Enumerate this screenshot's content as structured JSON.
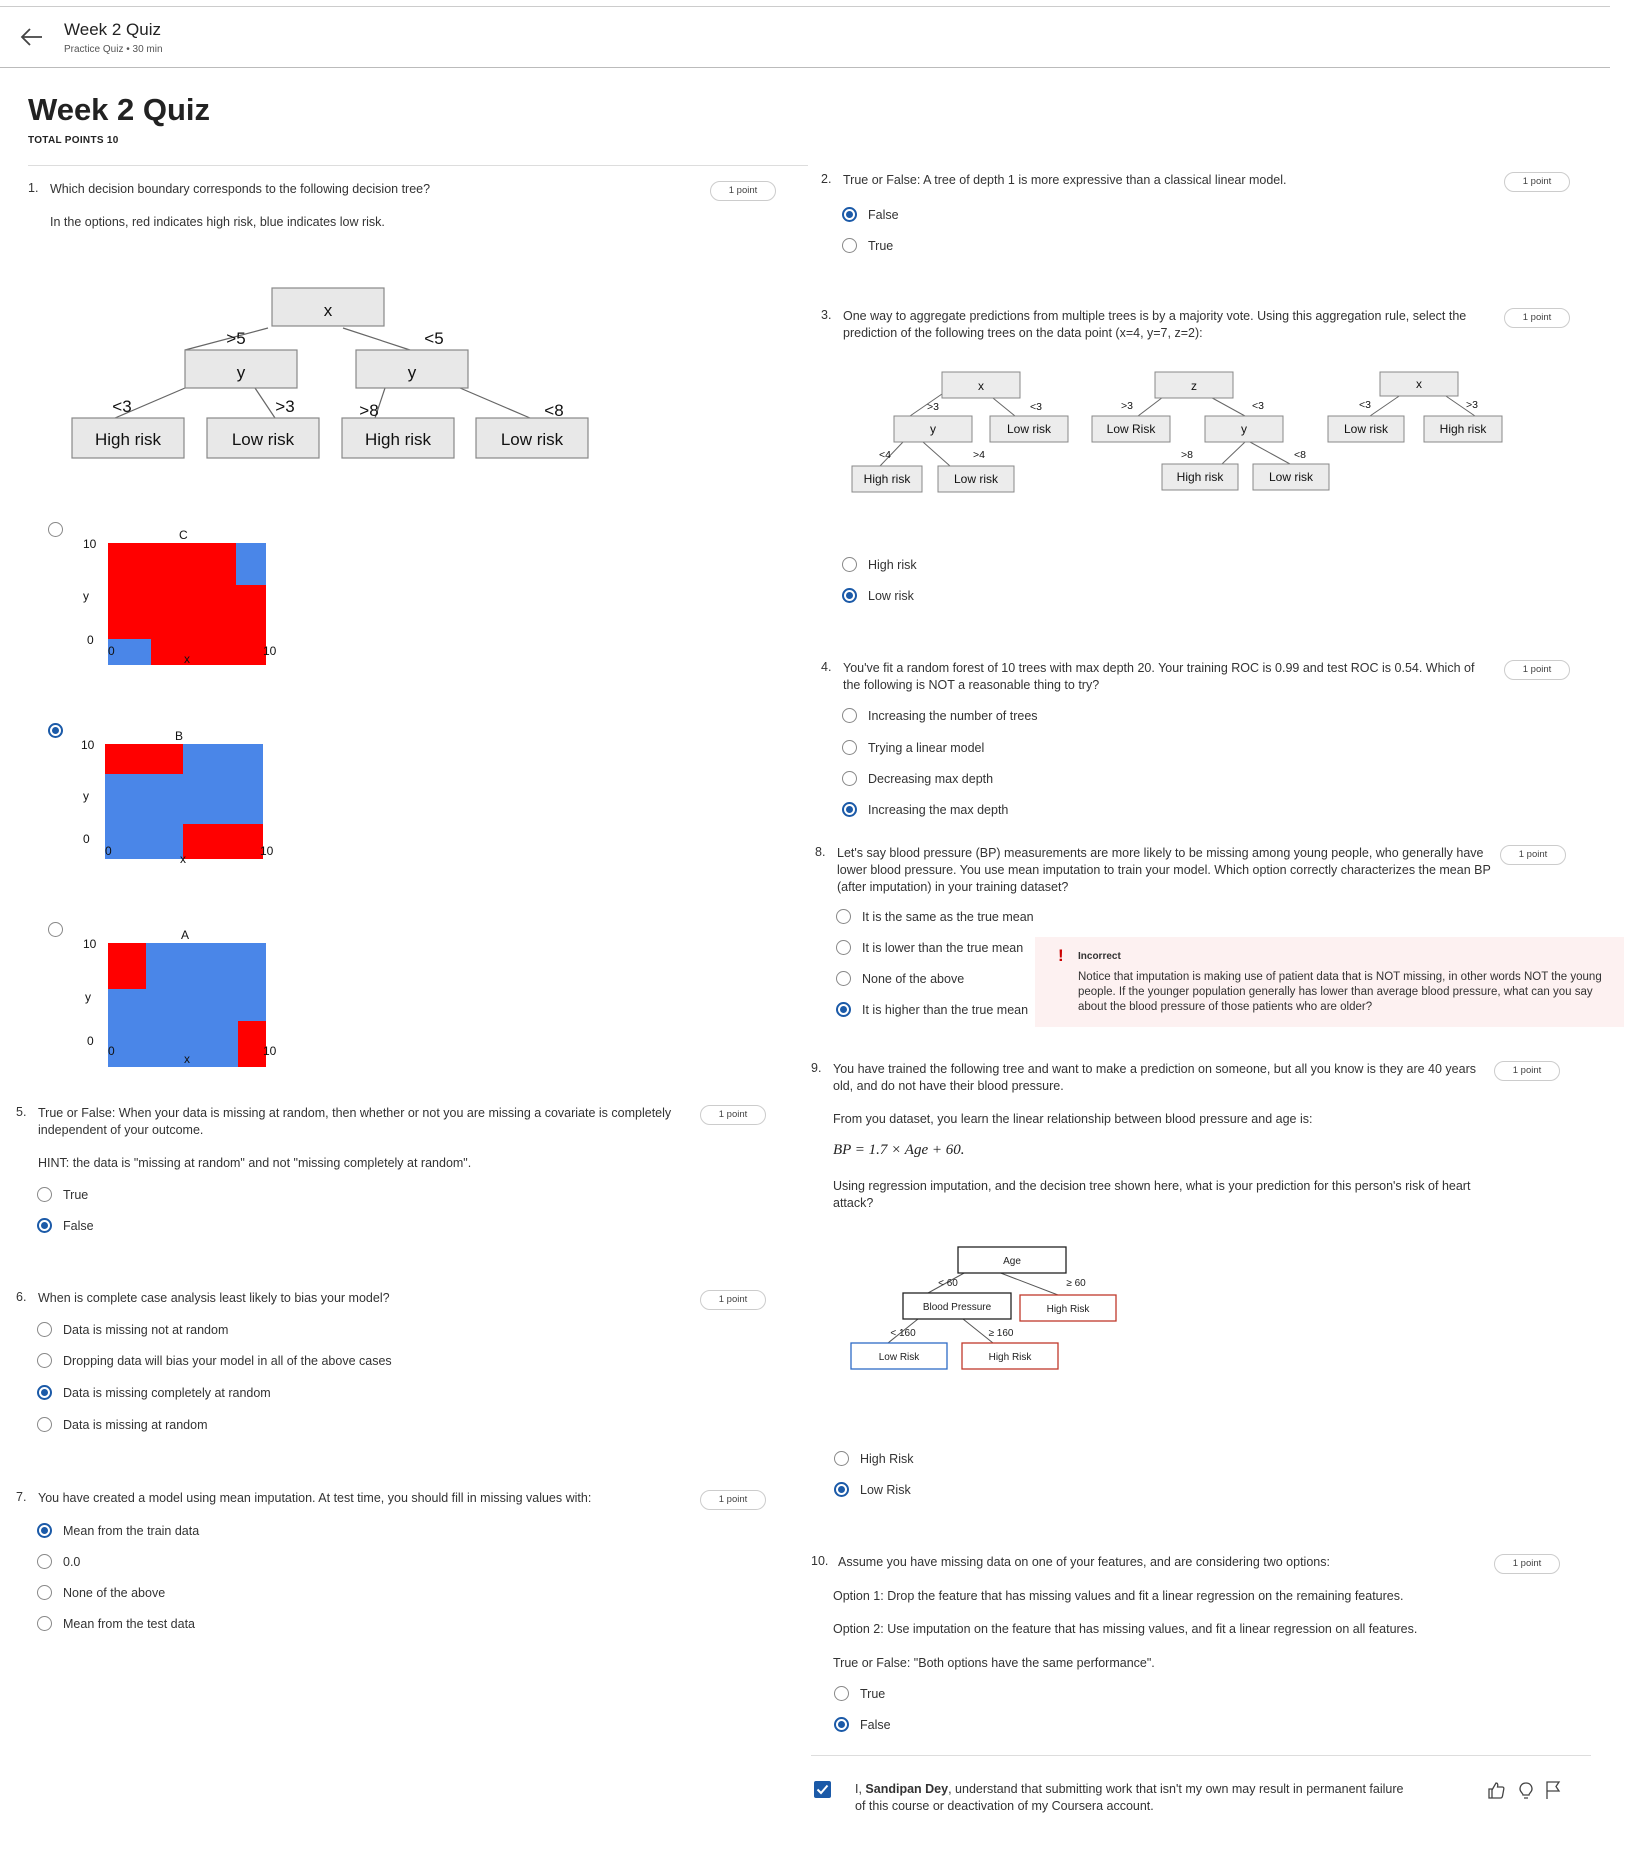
{
  "header": {
    "title": "Week 2 Quiz",
    "subtitle": "Practice Quiz • 30 min"
  },
  "page": {
    "title": "Week 2 Quiz",
    "total_points": "TOTAL POINTS 10"
  },
  "point_label": "1 point",
  "q1": {
    "number": "1.",
    "text": "Which decision boundary corresponds to the following decision tree?",
    "note": "In the options, red indicates high risk, blue indicates low risk.",
    "tree": {
      "root": "x",
      "left_edge": ">5",
      "right_edge": "<5",
      "left_node": "y",
      "right_node": "y",
      "ll_edge": "<3",
      "lr_edge": ">3",
      "rl_edge": ">8",
      "rr_edge": "<8",
      "leaves": [
        "High risk",
        "Low risk",
        "High risk",
        "Low risk"
      ]
    },
    "options": [
      {
        "label": "C",
        "selected": false
      },
      {
        "label": "B",
        "selected": true
      },
      {
        "label": "A",
        "selected": false
      }
    ],
    "plot_axis": {
      "y_label": "y",
      "x_label": "x",
      "tick_10": "10",
      "tick_0": "0"
    },
    "colors": {
      "high": "#ff0000",
      "low": "#4a86e8"
    }
  },
  "q2": {
    "number": "2.",
    "text": "True or False: A tree of depth 1 is more expressive than a classical linear model.",
    "options": [
      {
        "label": "False",
        "selected": true
      },
      {
        "label": "True",
        "selected": false
      }
    ]
  },
  "q3": {
    "number": "3.",
    "text": "One way to aggregate predictions from multiple trees is by a majority vote. Using this aggregation rule, select the prediction of the following trees on the data point (x=4, y=7, z=2):",
    "tree1": {
      "root": "x",
      "e1": ">3",
      "e2": "<3",
      "n1": "y",
      "leaf_r": "Low risk",
      "e3": "<4",
      "e4": ">4",
      "leaf_a": "High risk",
      "leaf_b": "Low risk"
    },
    "tree2": {
      "root": "z",
      "e1": ">3",
      "e2": "<3",
      "leaf_l": "Low Risk",
      "n1": "y",
      "e3": ">8",
      "e4": "<8",
      "leaf_a": "High risk",
      "leaf_b": "Low risk"
    },
    "tree3": {
      "root": "x",
      "e1": "<3",
      "e2": ">3",
      "leaf_l": "Low risk",
      "leaf_r": "High risk"
    },
    "options": [
      {
        "label": "High risk",
        "selected": false
      },
      {
        "label": "Low risk",
        "selected": true
      }
    ]
  },
  "q4": {
    "number": "4.",
    "text": "You've fit a random forest of 10 trees with max depth 20. Your training ROC is 0.99 and test ROC is 0.54. Which of the following is NOT a reasonable thing to try?",
    "options": [
      {
        "label": "Increasing the number of trees",
        "selected": false
      },
      {
        "label": "Trying a linear model",
        "selected": false
      },
      {
        "label": "Decreasing max depth",
        "selected": false
      },
      {
        "label": "Increasing the max depth",
        "selected": true
      }
    ]
  },
  "q5": {
    "number": "5.",
    "text": "True or False: When your data is missing at random, then whether or not you are missing a covariate is completely independent of your outcome.",
    "hint": "HINT: the data is \"missing at random\" and not \"missing completely at random\".",
    "options": [
      {
        "label": "True",
        "selected": false
      },
      {
        "label": "False",
        "selected": true
      }
    ]
  },
  "q6": {
    "number": "6.",
    "text": "When is complete case analysis least likely to bias your model?",
    "options": [
      {
        "label": "Data is missing not at random",
        "selected": false
      },
      {
        "label": "Dropping data will bias your model in all of the above cases",
        "selected": false
      },
      {
        "label": "Data is missing completely at random",
        "selected": true
      },
      {
        "label": "Data is missing at random",
        "selected": false
      }
    ]
  },
  "q7": {
    "number": "7.",
    "text": "You have created a model using mean imputation. At test time, you should fill in missing values with:",
    "options": [
      {
        "label": "Mean from the train data",
        "selected": true
      },
      {
        "label": "0.0",
        "selected": false
      },
      {
        "label": "None of the above",
        "selected": false
      },
      {
        "label": "Mean from the test data",
        "selected": false
      }
    ]
  },
  "q8": {
    "number": "8.",
    "text": "Let's say blood pressure (BP) measurements are more likely to be missing among young people, who generally have lower blood pressure. You use mean imputation to train your model. Which option correctly characterizes the mean BP (after imputation) in your training dataset?",
    "options": [
      {
        "label": "It is the same as the true mean",
        "selected": false
      },
      {
        "label": "It is lower than the true mean",
        "selected": false
      },
      {
        "label": "None of the above",
        "selected": false
      },
      {
        "label": "It is higher than the true mean",
        "selected": true
      }
    ],
    "feedback_title": "Incorrect",
    "feedback_text": "Notice that imputation is making use of patient data that is NOT missing, in other words NOT the young people. If the younger population generally has lower than average blood pressure, what can you say about the blood pressure of those patients who are older?"
  },
  "q9": {
    "number": "9.",
    "text": "You have trained the following tree and want to make a prediction on someone, but all you know is they are 40 years old, and do not have their blood pressure.",
    "text2": "From you dataset, you learn the linear relationship between blood pressure and age is:",
    "formula": "BP = 1.7 × Age + 60.",
    "text3": "Using regression imputation, and the decision tree shown here, what is your prediction for this person's risk of heart attack?",
    "tree": {
      "root": "Age",
      "e_left": "< 60",
      "e_right": "≥ 60",
      "n1": "Blood Pressure",
      "leaf_r": "High Risk",
      "e3": "< 160",
      "e4": "≥ 160",
      "leaf_a": "Low Risk",
      "leaf_b": "High Risk"
    },
    "options": [
      {
        "label": "High Risk",
        "selected": false
      },
      {
        "label": "Low Risk",
        "selected": true
      }
    ]
  },
  "q10": {
    "number": "10.",
    "text": "Assume you have missing data on one of your features, and are considering two options:",
    "opt1": "Option 1: Drop the feature that has missing values and fit a linear regression on the remaining features.",
    "opt2": "Option 2: Use imputation on the feature that has missing values, and fit a linear regression on all features.",
    "tf": "True or False: \"Both options have the same performance\".",
    "options": [
      {
        "label": "True",
        "selected": false
      },
      {
        "label": "False",
        "selected": true
      }
    ]
  },
  "honor": {
    "prefix": "I, ",
    "name": "Sandipan Dey",
    "suffix": ", understand that submitting work that isn't my own may result in permanent failure of this course or deactivation of my Coursera account."
  }
}
